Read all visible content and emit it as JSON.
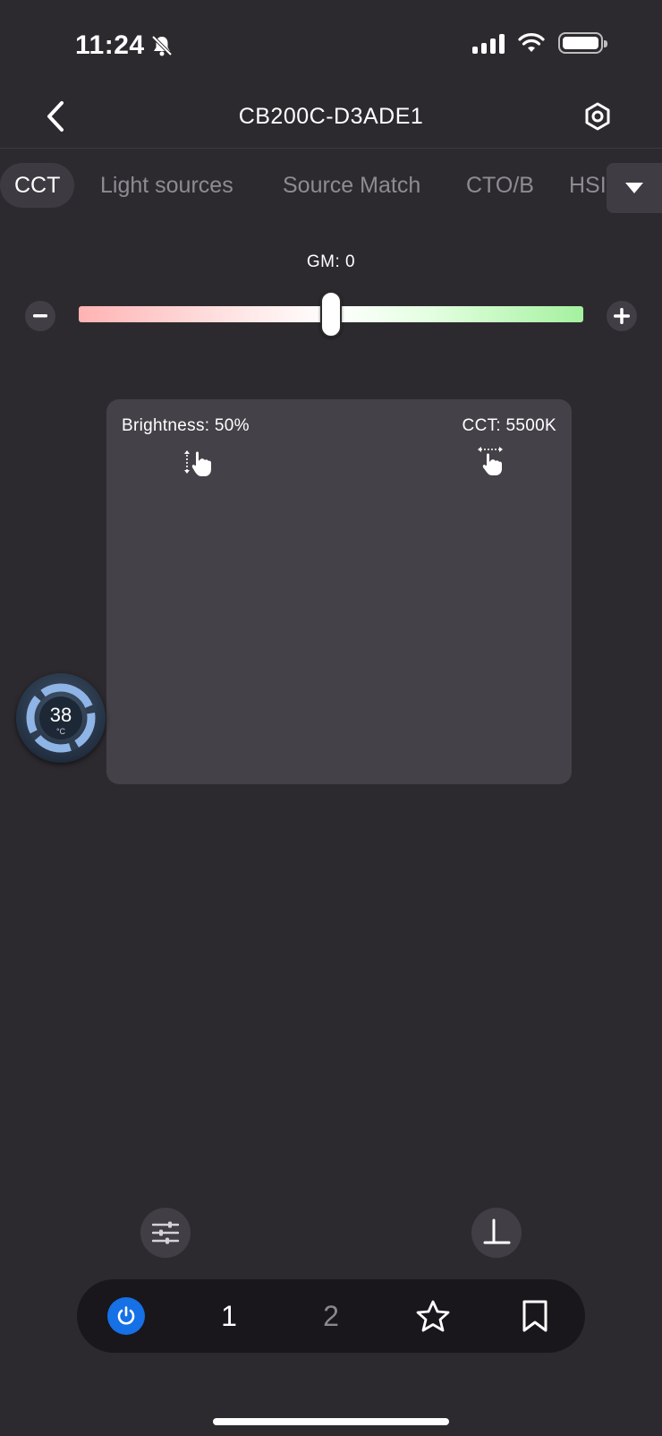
{
  "status_bar": {
    "time": "11:24"
  },
  "nav": {
    "title": "CB200C-D3ADE1"
  },
  "tabs": [
    {
      "label": "CCT",
      "active": true
    },
    {
      "label": "Light sources",
      "active": false
    },
    {
      "label": "Source Match",
      "active": false
    },
    {
      "label": "CTO/B",
      "active": false
    },
    {
      "label": "HSI",
      "active": false
    }
  ],
  "gm": {
    "label": "GM:  0",
    "value": 0,
    "min": -1,
    "max": 1
  },
  "pad": {
    "brightness_label": "Brightness:  50%",
    "cct_label": "CCT:  5500K"
  },
  "temperature": {
    "value": "38",
    "unit": "°C"
  },
  "bottom_bar": {
    "items": [
      {
        "icon": "power-icon",
        "active": true
      },
      {
        "label": "1",
        "active": true
      },
      {
        "label": "2",
        "active": false
      },
      {
        "icon": "star-icon"
      },
      {
        "icon": "bookmark-icon"
      }
    ]
  },
  "colors": {
    "background": "#2d2a2f",
    "pad": "#454148",
    "accent": "#1670e6",
    "gm_left": "#ffb3b3",
    "gm_right": "#a4f19f"
  }
}
